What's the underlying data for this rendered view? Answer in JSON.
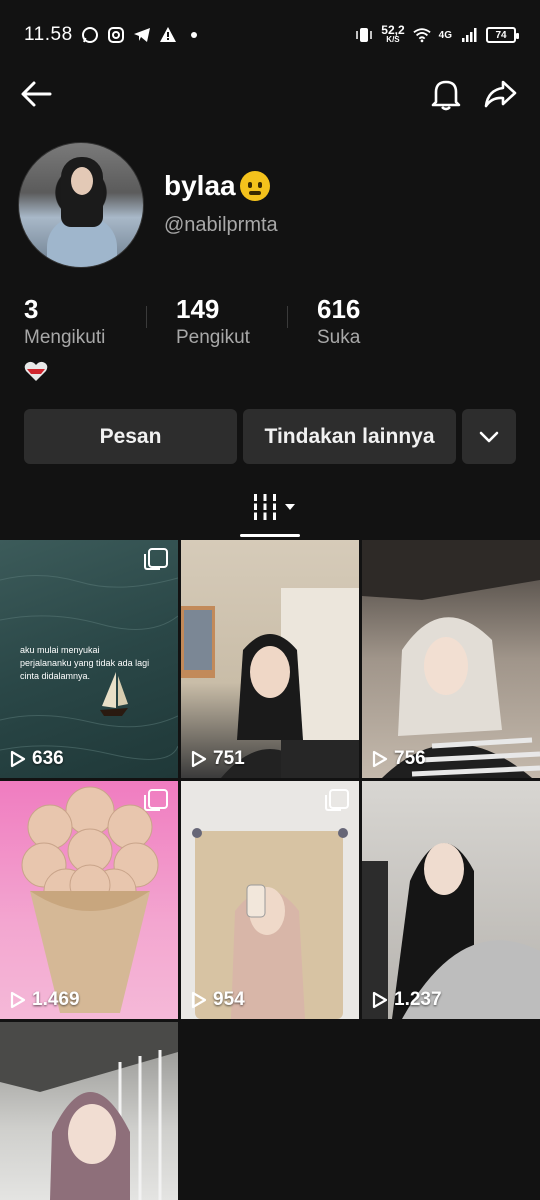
{
  "status_bar": {
    "time": "11.58",
    "net_speed": "52,2",
    "net_unit": "K/S",
    "signal": "4G",
    "battery": "74"
  },
  "profile": {
    "display_name": "bylaa",
    "handle": "@nabilprmta"
  },
  "stats": [
    {
      "value": "3",
      "label": "Mengikuti"
    },
    {
      "value": "149",
      "label": "Pengikut"
    },
    {
      "value": "616",
      "label": "Suka"
    }
  ],
  "actions": {
    "message": "Pesan",
    "more_actions": "Tindakan lainnya"
  },
  "videos": [
    {
      "views": "636",
      "caption": "aku mulai menyukai perjalananku yang tidak ada lagi cinta didalamnya."
    },
    {
      "views": "751"
    },
    {
      "views": "756"
    },
    {
      "views": "1.469"
    },
    {
      "views": "954"
    },
    {
      "views": "1.237"
    },
    {
      "views": ""
    }
  ],
  "icons": [
    "back-arrow-icon",
    "bell-icon",
    "share-icon",
    "chevron-down-icon",
    "grid-icon",
    "play-icon"
  ]
}
